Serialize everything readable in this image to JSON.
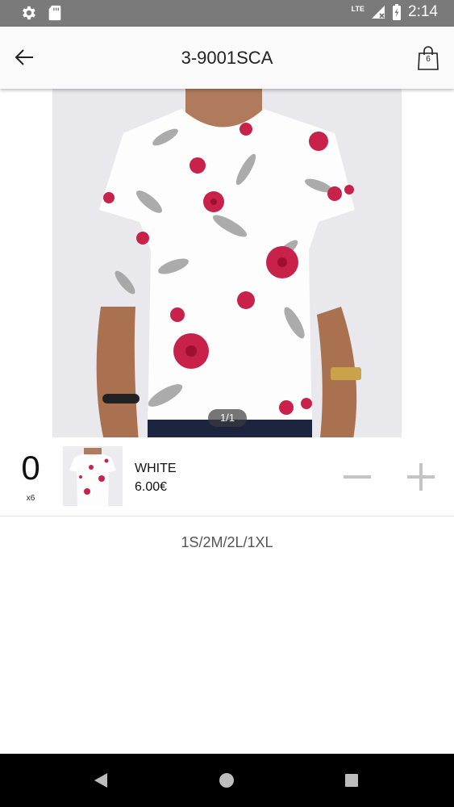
{
  "status_bar": {
    "time": "2:14",
    "network": "LTE",
    "icons": [
      "gear-icon",
      "sd-card-icon",
      "signal-icon",
      "battery-icon"
    ]
  },
  "app_bar": {
    "title": "3-9001SCA",
    "bag_count": "6",
    "icons": [
      "back-arrow-icon",
      "shopping-bag-icon"
    ]
  },
  "gallery": {
    "pager": "1/1"
  },
  "item": {
    "quantity": "0",
    "multiplier": "x6",
    "color": "WHITE",
    "price": "6.00€"
  },
  "sizes": "1S/2M/2L/1XL",
  "nav_bar": {
    "icons": [
      "nav-back-icon",
      "nav-home-icon",
      "nav-recents-icon"
    ]
  },
  "colors": {
    "status_bar": "#7a7a7a",
    "app_bar": "#fafafa",
    "flower": "#c8224a",
    "control_gray": "#c4c4c4"
  }
}
